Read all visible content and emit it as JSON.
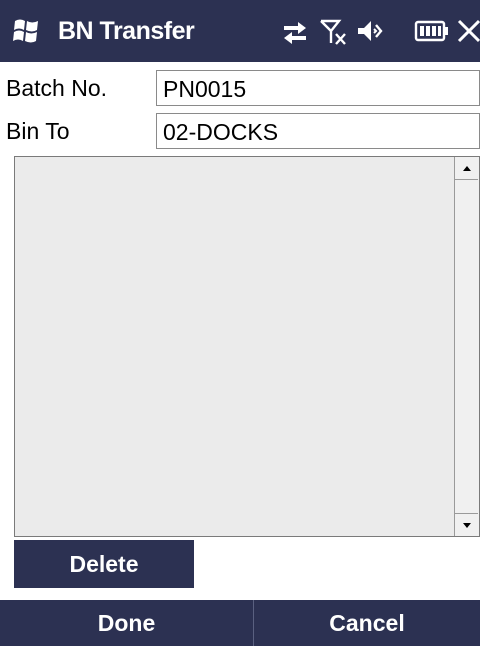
{
  "titlebar": {
    "title": "BN Transfer",
    "icons": [
      "windows-flag-icon",
      "connectivity-icon",
      "no-signal-icon",
      "speaker-icon",
      "battery-icon",
      "close-icon"
    ],
    "bg_color": "#2c3152"
  },
  "form": {
    "batch_label": "Batch No.",
    "batch_value": "PN0015",
    "bin_label": "Bin To",
    "bin_value": "02-DOCKS"
  },
  "buttons": {
    "delete_label": "Delete",
    "done_label": "Done",
    "cancel_label": "Cancel"
  }
}
